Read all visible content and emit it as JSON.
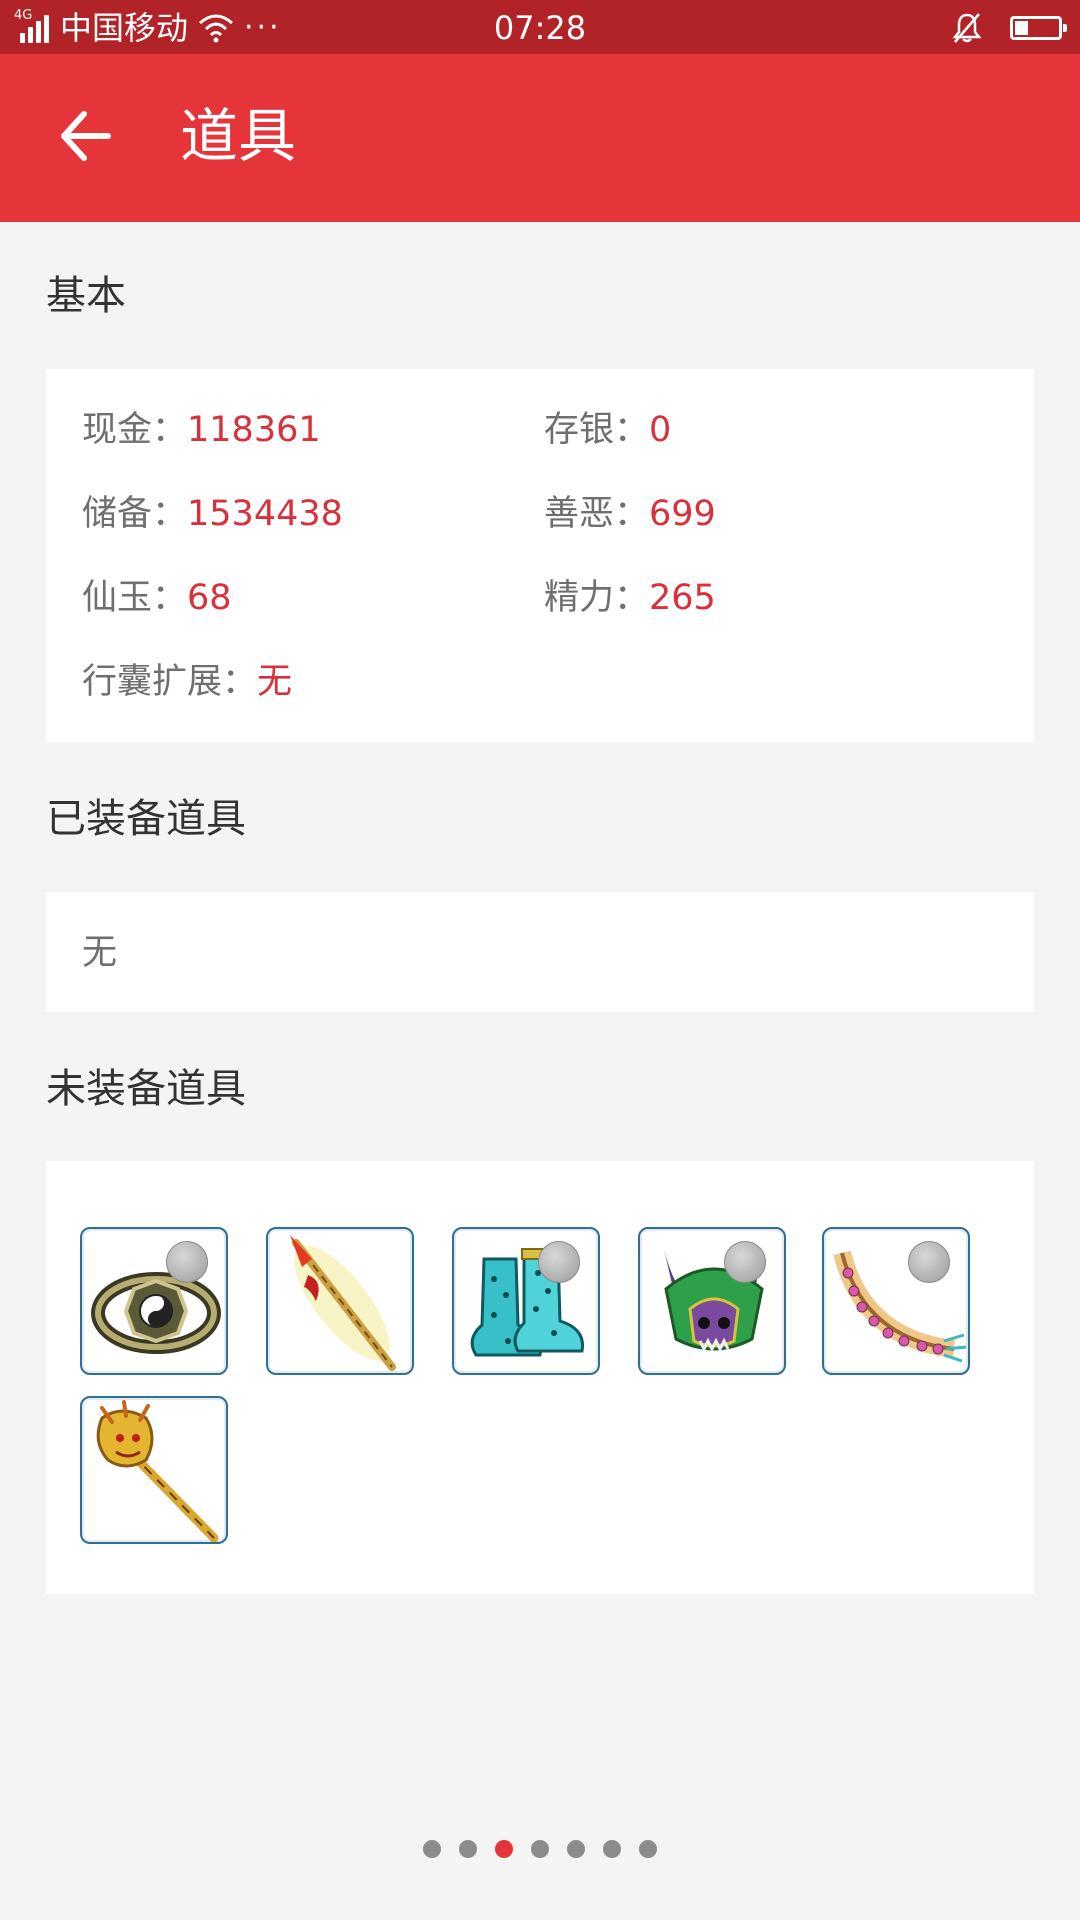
{
  "status_bar": {
    "network": "4G",
    "carrier": "中国移动",
    "more": "···",
    "time": "07:28"
  },
  "app_bar": {
    "title": "道具"
  },
  "basic": {
    "title": "基本",
    "fields": [
      {
        "label": "现金：",
        "value": "118361"
      },
      {
        "label": "存银：",
        "value": "0"
      },
      {
        "label": "储备：",
        "value": "1534438"
      },
      {
        "label": "善恶：",
        "value": "699"
      },
      {
        "label": "仙玉：",
        "value": "68"
      },
      {
        "label": "精力：",
        "value": "265"
      },
      {
        "label": "行囊扩展：",
        "value": "无"
      }
    ]
  },
  "equipped": {
    "title": "已装备道具",
    "empty_text": "无"
  },
  "unequipped": {
    "title": "未装备道具",
    "items": [
      {
        "icon": "bagua-ring-icon",
        "locked": true
      },
      {
        "icon": "flame-spear-icon",
        "locked": false
      },
      {
        "icon": "spotted-boots-icon",
        "locked": true
      },
      {
        "icon": "horned-helmet-icon",
        "locked": true
      },
      {
        "icon": "bead-sash-icon",
        "locked": true
      },
      {
        "icon": "dragon-staff-icon",
        "locked": false
      }
    ]
  },
  "pager": {
    "count": 7,
    "active_index": 2
  },
  "colors": {
    "status_bar": "#b22328",
    "app_bar": "#e5353a",
    "value_text": "#d9303a",
    "label_text": "#6f6f6f",
    "background": "#f4f4f4"
  }
}
